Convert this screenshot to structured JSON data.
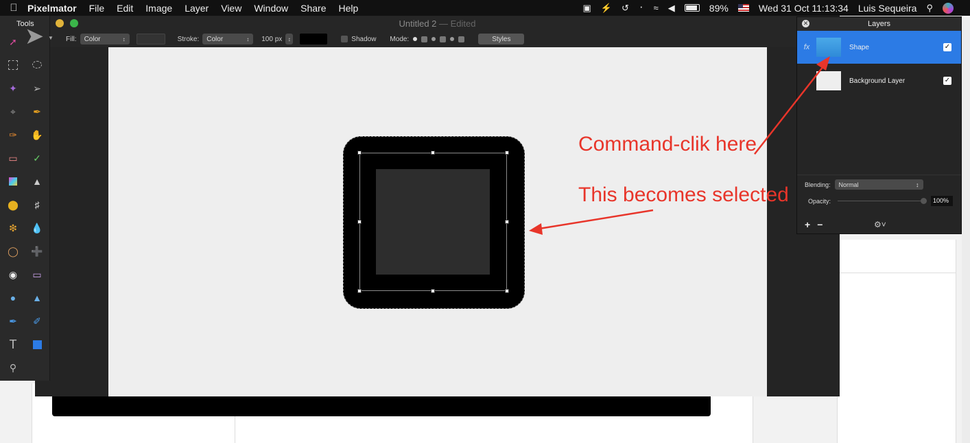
{
  "menubar": {
    "apple": "",
    "app_name": "Pixelmator",
    "menus": [
      "File",
      "Edit",
      "Image",
      "Layer",
      "View",
      "Window",
      "Share",
      "Help"
    ],
    "battery_percent": "89%",
    "datetime": "Wed 31 Oct  11:13:34",
    "user": "Luis Sequeira",
    "icons": [
      "app-m-icon",
      "bolt-icon",
      "time-machine-icon",
      "bluetooth-icon",
      "wifi-icon",
      "volume-icon",
      "battery-icon",
      "flag-icon",
      "search-icon",
      "siri-icon"
    ]
  },
  "window": {
    "title": "Untitled 2",
    "edited": " — Edited"
  },
  "toolbar": {
    "fill_label": "Fill:",
    "fill_value": "Color",
    "stroke_label": "Stroke:",
    "stroke_value": "Color",
    "stroke_width": "100 px",
    "shadow_label": "Shadow",
    "mode_label": "Mode:",
    "styles_label": "Styles"
  },
  "tools": {
    "title": "Tools"
  },
  "annotations": {
    "command_click": "Command-clik here",
    "becomes_selected": "This becomes selected"
  },
  "layers": {
    "title": "Layers",
    "items": [
      {
        "name": "Shape",
        "fx": "fx",
        "visible": true,
        "selected": true
      },
      {
        "name": "Background Layer",
        "fx": "",
        "visible": true,
        "selected": false
      }
    ],
    "blending_label": "Blending:",
    "blending_value": "Normal",
    "opacity_label": "Opacity:",
    "opacity_value": "100%",
    "add_label": "+",
    "remove_label": "−"
  },
  "colors": {
    "accent": "#2c7be5",
    "annotation": "#e8352a"
  }
}
